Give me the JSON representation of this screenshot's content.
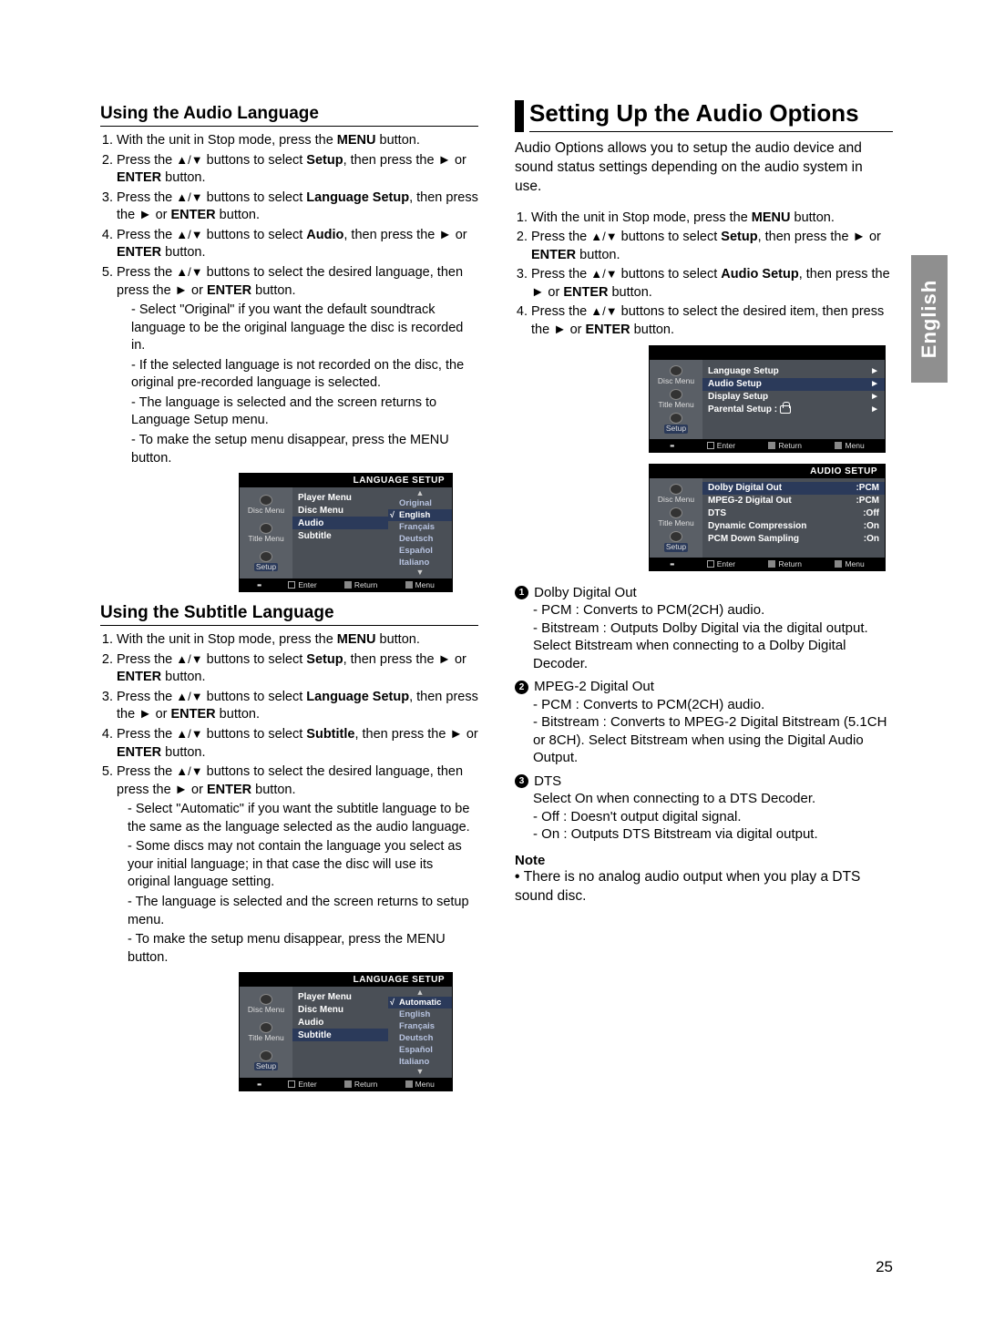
{
  "page_number": "25",
  "language_tab": "English",
  "symbols": {
    "updown": "▲/▼",
    "right": "►"
  },
  "left_column": {
    "sec1": {
      "heading": "Using the Audio Language",
      "steps": [
        {
          "pre": "With the unit in Stop mode, press the ",
          "b1": "MENU",
          "post": " button."
        },
        {
          "pre": "Press the ",
          "sym": "updown",
          "mid": " buttons to select ",
          "b1": "Setup",
          "mid2": ", then press the ",
          "sym2": "right",
          "post": " or ",
          "b2": "ENTER",
          "post2": " button."
        },
        {
          "pre": "Press the ",
          "sym": "updown",
          "mid": " buttons to select ",
          "b1": "Language Setup",
          "mid2": ", then press the ",
          "sym2": "right",
          "post": " or ",
          "b2": "ENTER",
          "post2": " button."
        },
        {
          "pre": "Press the ",
          "sym": "updown",
          "mid": " buttons to select ",
          "b1": "Audio",
          "mid2": ", then press the ",
          "sym2": "right",
          "post": " or ",
          "b2": "ENTER",
          "post2": " button."
        },
        {
          "pre": "Press the ",
          "sym": "updown",
          "mid": " buttons to select the desired language, then press the ",
          "sym2": "right",
          "post": " or ",
          "b2": "ENTER",
          "post2": " button."
        }
      ],
      "sub_bullets": [
        "Select \"Original\" if you want the default soundtrack language to be the original language the disc is recorded in.",
        "If the selected language is not recorded on the disc, the original pre-recorded language is selected.",
        "The language is selected and the screen returns to Language Setup menu.",
        "To make the setup menu disappear, press the MENU button."
      ]
    },
    "sec2": {
      "heading": "Using the Subtitle Language",
      "steps": [
        {
          "pre": "With the unit in Stop mode, press the ",
          "b1": "MENU",
          "post": " button."
        },
        {
          "pre": "Press the ",
          "sym": "updown",
          "mid": " buttons to select ",
          "b1": "Setup",
          "mid2": ", then press the ",
          "sym2": "right",
          "post": " or ",
          "b2": "ENTER",
          "post2": " button."
        },
        {
          "pre": "Press the ",
          "sym": "updown",
          "mid": " buttons to select ",
          "b1": "Language Setup",
          "mid2": ", then press the ",
          "sym2": "right",
          "post": " or ",
          "b2": "ENTER",
          "post2": " button."
        },
        {
          "pre": "Press the ",
          "sym": "updown",
          "mid": " buttons to select ",
          "b1": "Subtitle",
          "mid2": ", then press the ",
          "sym2": "right",
          "post": " or ",
          "b2": "ENTER",
          "post2": " button."
        },
        {
          "pre": "Press the ",
          "sym": "updown",
          "mid": " buttons to select the desired  language, then press the ",
          "sym2": "right",
          "post": " or ",
          "b2": "ENTER",
          "post2": " button."
        }
      ],
      "sub_bullets": [
        "Select \"Automatic\" if you want the subtitle  language to be the same as the language selected as the audio language.",
        "Some discs may not contain the language you  select as your initial language; in that case the disc will use its original language setting.",
        "The language is selected and the screen returns to setup menu.",
        "To make the setup menu disappear, press the MENU button."
      ]
    }
  },
  "right_column": {
    "big_heading": "Setting Up the Audio Options",
    "intro": "Audio Options allows you to setup the audio device and sound status settings depending on the audio system in use.",
    "steps": [
      {
        "pre": "With the unit in Stop mode, press the ",
        "b1": "MENU",
        "post": " button."
      },
      {
        "pre": "Press the ",
        "sym": "updown",
        "mid": " buttons to select ",
        "b1": "Setup",
        "mid2": ", then press the ",
        "sym2": "right",
        "post": " or ",
        "b2": "ENTER",
        "post2": " button."
      },
      {
        "pre": "Press the ",
        "sym": "updown",
        "mid": " buttons to select ",
        "b1": "Audio Setup",
        "mid2": ", then press the ",
        "sym2": "right",
        "post": " or ",
        "b2": "ENTER",
        "post2": " button."
      },
      {
        "pre": "Press the ",
        "sym": "updown",
        "mid": " buttons to select the desired item, then press the ",
        "sym2": "right",
        "post": " or ",
        "b2": "ENTER",
        "post2": " button."
      }
    ],
    "options": [
      {
        "num": "1",
        "title": "Dolby Digital Out",
        "lines": [
          "PCM : Converts to PCM(2CH) audio.",
          "Bitstream : Outputs Dolby Digital via the digital output. Select Bitstream when connecting to a Dolby Digital Decoder."
        ]
      },
      {
        "num": "2",
        "title": "MPEG-2 Digital Out",
        "lines": [
          "PCM : Converts to PCM(2CH) audio.",
          "Bitstream : Converts to MPEG-2 Digital Bitstream (5.1CH or 8CH). Select Bitstream when using the Digital Audio Output."
        ]
      },
      {
        "num": "3",
        "title": "DTS",
        "plain": "Select On when connecting to a DTS Decoder.",
        "lines": [
          "Off : Doesn't output digital signal.",
          "On : Outputs DTS Bitstream via digital output."
        ]
      }
    ],
    "note_head": "Note",
    "note_body": "There is no analog audio output when you play a DTS sound disc."
  },
  "osd": {
    "side_items": [
      {
        "label": "Disc Menu"
      },
      {
        "label": "Title Menu"
      },
      {
        "label": "Setup",
        "setup": true,
        "hi": true
      }
    ],
    "foot": [
      {
        "label": "Enter"
      },
      {
        "label": "Return"
      },
      {
        "label": "Menu"
      }
    ],
    "lang_audio": {
      "title": "LANGUAGE SETUP",
      "rows": [
        {
          "label": "Player Menu"
        },
        {
          "label": "Disc Menu"
        },
        {
          "label": "Audio",
          "hi": true
        },
        {
          "label": "Subtitle"
        }
      ],
      "opts": [
        "Original",
        "English",
        "Français",
        "Deutsch",
        "Español",
        "Italiano"
      ],
      "sel_index": 1,
      "check_index": 1
    },
    "lang_subtitle": {
      "title": "LANGUAGE SETUP",
      "rows": [
        {
          "label": "Player Menu"
        },
        {
          "label": "Disc Menu"
        },
        {
          "label": "Audio"
        },
        {
          "label": "Subtitle",
          "hi": true
        }
      ],
      "opts": [
        "Automatic",
        "English",
        "Français",
        "Deutsch",
        "Español",
        "Italiano"
      ],
      "sel_index": 0,
      "check_index": 0
    },
    "setup_main": {
      "rows": [
        {
          "label": "Language Setup",
          "arrow": "►"
        },
        {
          "label": "Audio Setup",
          "hi": true,
          "arrow": "►"
        },
        {
          "label": "Display Setup",
          "arrow": "►"
        },
        {
          "label": "Parental Setup :",
          "lock": true,
          "arrow": "►"
        }
      ]
    },
    "audio_setup": {
      "title": "AUDIO SETUP",
      "rows": [
        {
          "label": "Dolby Digital Out",
          "val": ":PCM",
          "hi": true
        },
        {
          "label": "MPEG-2 Digital Out",
          "val": ":PCM"
        },
        {
          "label": "DTS",
          "val": ":Off"
        },
        {
          "label": "Dynamic Compression",
          "val": ":On"
        },
        {
          "label": "PCM Down Sampling",
          "val": ":On"
        }
      ]
    }
  }
}
